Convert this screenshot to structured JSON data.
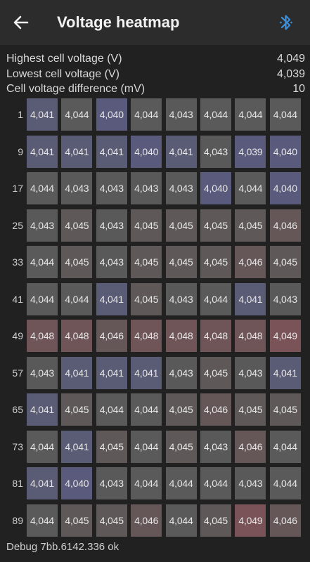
{
  "header": {
    "title": "Voltage heatmap",
    "back_icon": "arrow-back-icon",
    "bluetooth_icon": "bluetooth-icon",
    "bluetooth_color": "#3d8fd6"
  },
  "stats": [
    {
      "label": "Highest cell voltage (V)",
      "value": "4,049"
    },
    {
      "label": "Lowest cell voltage (V)",
      "value": "4,039"
    },
    {
      "label": "Cell voltage difference (mV)",
      "value": "10"
    }
  ],
  "heatmap": {
    "colors": {
      "4,039": "#5a5a7c",
      "4,040": "#595a7c",
      "4,041": "#5a5b74",
      "4,043": "#595959",
      "4,044": "#5a5a5a",
      "4,045": "#5e5858",
      "4,046": "#655657",
      "4,048": "#6f5558",
      "4,049": "#7a5358"
    },
    "rows": [
      {
        "label": "1",
        "values": [
          "4,041",
          "4,044",
          "4,040",
          "4,044",
          "4,043",
          "4,044",
          "4,044",
          "4,044"
        ]
      },
      {
        "label": "9",
        "values": [
          "4,041",
          "4,041",
          "4,041",
          "4,040",
          "4,041",
          "4,043",
          "4,039",
          "4,040"
        ]
      },
      {
        "label": "17",
        "values": [
          "4,044",
          "4,043",
          "4,043",
          "4,043",
          "4,043",
          "4,040",
          "4,044",
          "4,040"
        ]
      },
      {
        "label": "25",
        "values": [
          "4,043",
          "4,045",
          "4,043",
          "4,045",
          "4,045",
          "4,045",
          "4,045",
          "4,046"
        ]
      },
      {
        "label": "33",
        "values": [
          "4,044",
          "4,045",
          "4,043",
          "4,045",
          "4,045",
          "4,045",
          "4,046",
          "4,045"
        ]
      },
      {
        "label": "41",
        "values": [
          "4,044",
          "4,044",
          "4,041",
          "4,045",
          "4,043",
          "4,044",
          "4,041",
          "4,043"
        ]
      },
      {
        "label": "49",
        "values": [
          "4,048",
          "4,048",
          "4,046",
          "4,048",
          "4,048",
          "4,048",
          "4,048",
          "4,049"
        ]
      },
      {
        "label": "57",
        "values": [
          "4,043",
          "4,041",
          "4,041",
          "4,041",
          "4,043",
          "4,045",
          "4,043",
          "4,041"
        ]
      },
      {
        "label": "65",
        "values": [
          "4,041",
          "4,045",
          "4,044",
          "4,044",
          "4,045",
          "4,046",
          "4,045",
          "4,045"
        ]
      },
      {
        "label": "73",
        "values": [
          "4,044",
          "4,041",
          "4,045",
          "4,044",
          "4,045",
          "4,043",
          "4,046",
          "4,044"
        ]
      },
      {
        "label": "81",
        "values": [
          "4,041",
          "4,040",
          "4,043",
          "4,044",
          "4,044",
          "4,044",
          "4,043",
          "4,044"
        ]
      },
      {
        "label": "89",
        "values": [
          "4,044",
          "4,045",
          "4,045",
          "4,046",
          "4,044",
          "4,045",
          "4,049",
          "4,046"
        ]
      }
    ]
  },
  "footer": {
    "debug": "Debug 7bb.6142.336 ok"
  }
}
